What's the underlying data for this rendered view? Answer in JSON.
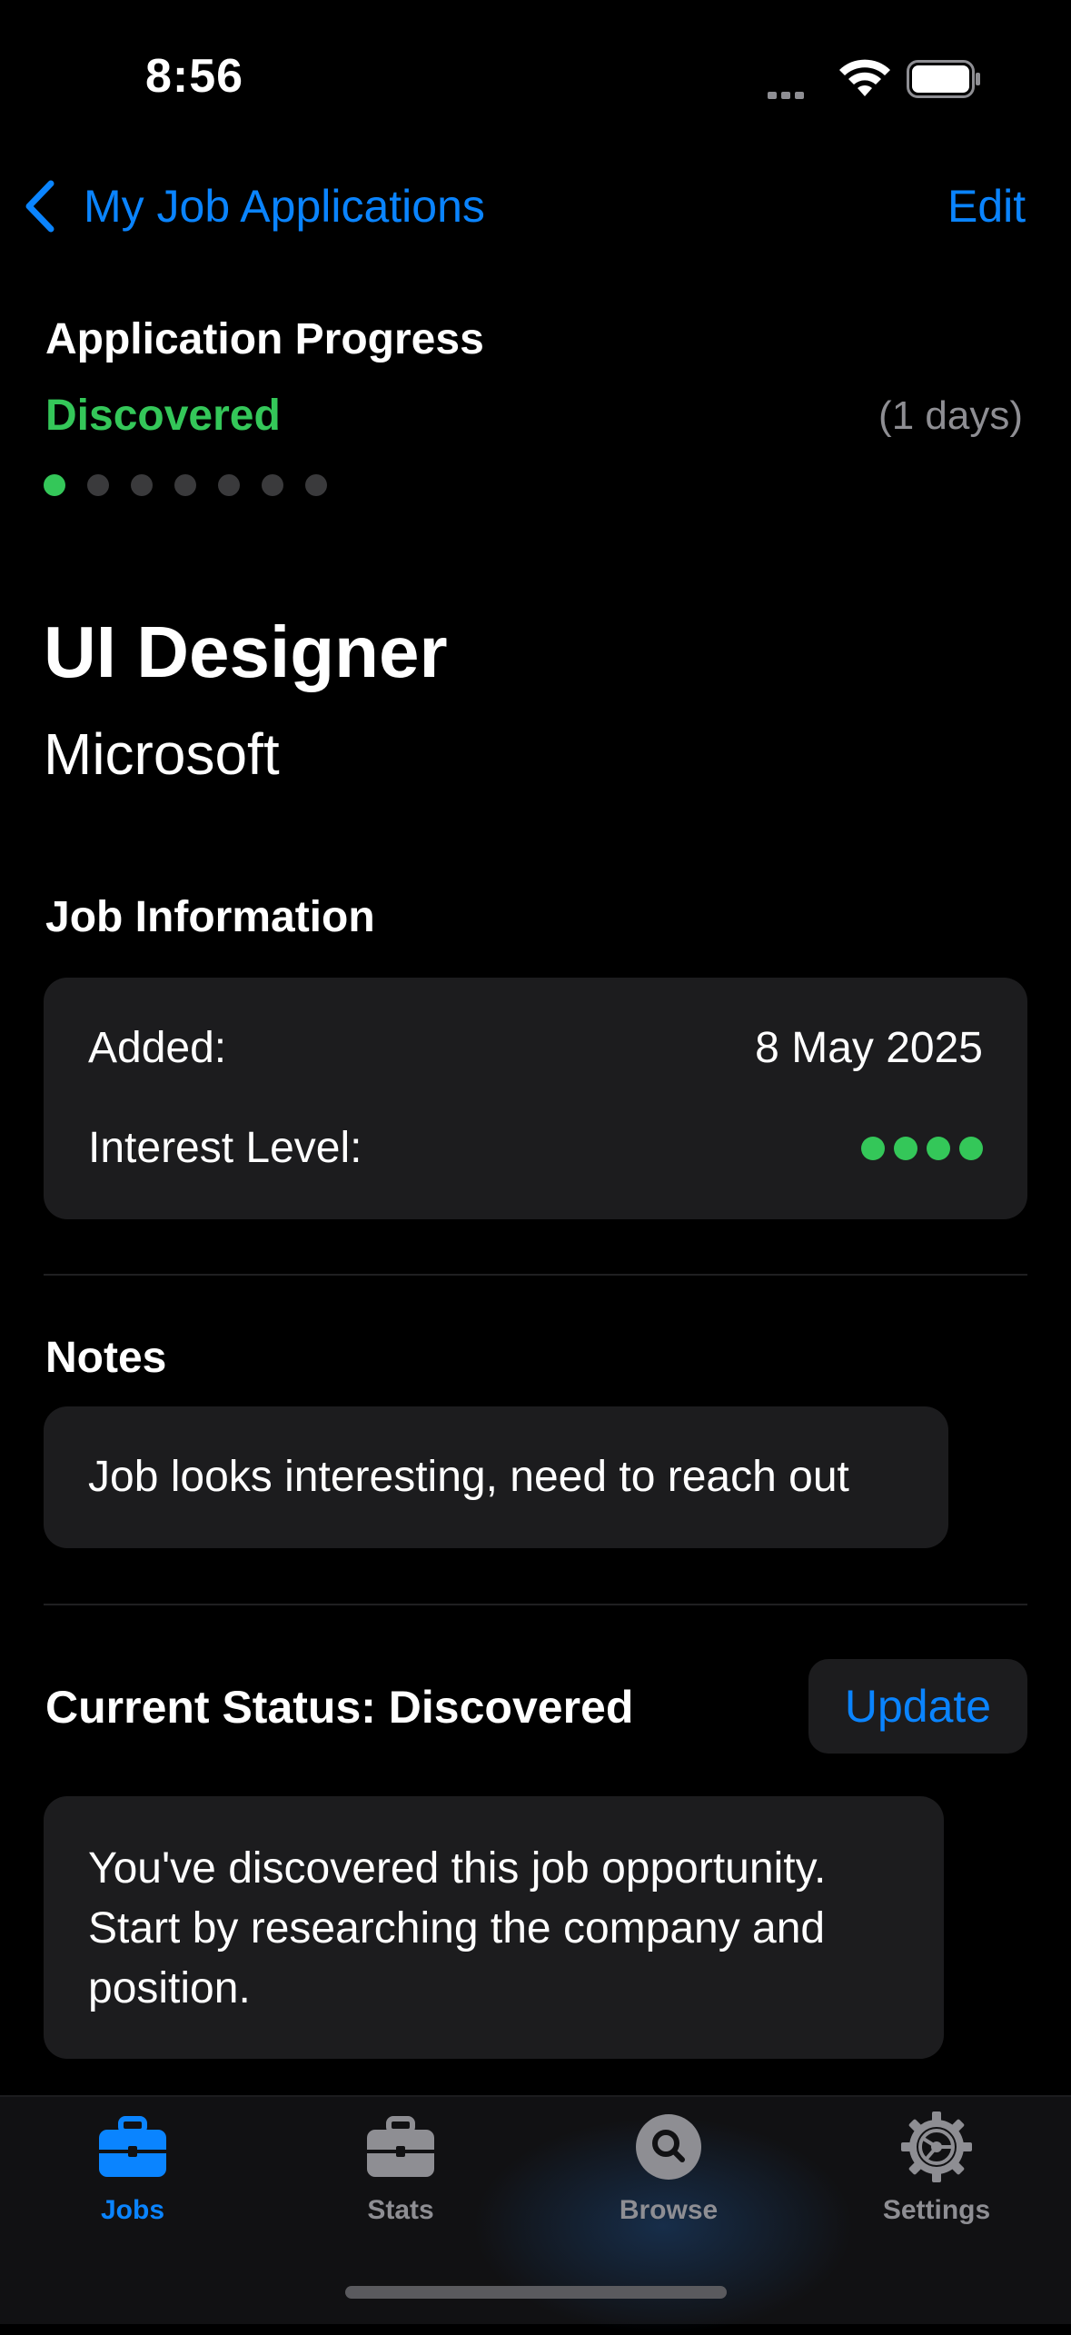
{
  "status_bar": {
    "time": "8:56"
  },
  "nav": {
    "back_label": "My Job Applications",
    "edit_label": "Edit"
  },
  "progress": {
    "title": "Application Progress",
    "stage": "Discovered",
    "days": "(1 days)",
    "total_steps": 7,
    "current_step": 1
  },
  "job": {
    "title": "UI Designer",
    "company": "Microsoft"
  },
  "job_info": {
    "heading": "Job Information",
    "added_label": "Added:",
    "added_value": "8 May 2025",
    "interest_label": "Interest Level:",
    "interest_level": 4
  },
  "notes": {
    "heading": "Notes",
    "text": "Job looks interesting, need to reach out"
  },
  "status": {
    "title": "Current Status: Discovered",
    "update_label": "Update",
    "description": "You've discovered this job opportunity. Start by researching the company and position."
  },
  "tabs": [
    {
      "label": "Jobs",
      "icon": "briefcase-icon",
      "active": true
    },
    {
      "label": "Stats",
      "icon": "briefcase-icon",
      "active": false
    },
    {
      "label": "Browse",
      "icon": "search-icon",
      "active": false
    },
    {
      "label": "Settings",
      "icon": "gear-icon",
      "active": false
    }
  ],
  "colors": {
    "accent": "#0a84ff",
    "success": "#34c759",
    "card": "#1c1c1e",
    "background": "#000000"
  }
}
